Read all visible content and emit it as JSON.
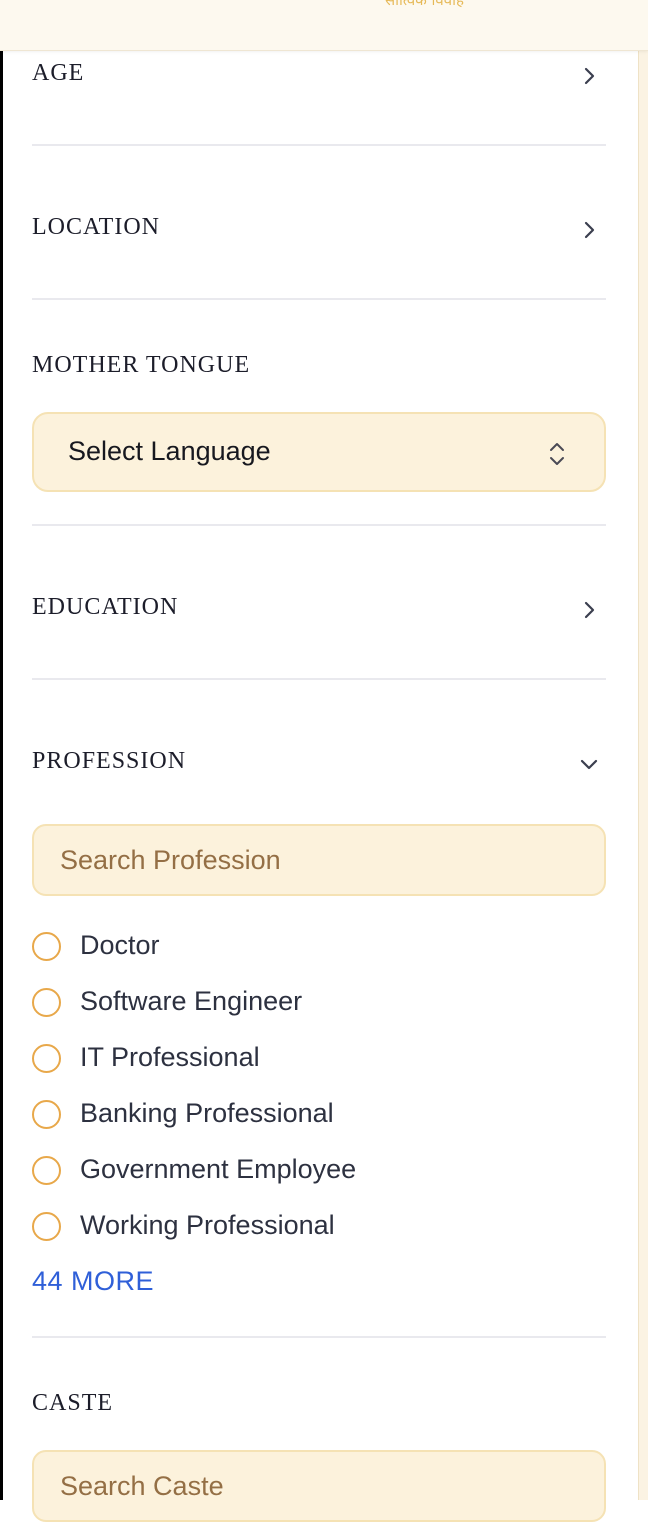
{
  "header": {
    "brand_text": "सात्विक विवाह"
  },
  "filters": {
    "age": {
      "title": "AGE"
    },
    "location": {
      "title": "LOCATION"
    },
    "mother_tongue": {
      "title": "MOTHER TONGUE",
      "select_value": "Select Language"
    },
    "education": {
      "title": "EDUCATION"
    },
    "profession": {
      "title": "PROFESSION",
      "search_placeholder": "Search Profession",
      "options": [
        {
          "label": "Doctor",
          "selected": false
        },
        {
          "label": "Software Engineer",
          "selected": false
        },
        {
          "label": "IT Professional",
          "selected": false
        },
        {
          "label": "Banking Professional",
          "selected": false
        },
        {
          "label": "Government Employee",
          "selected": false
        },
        {
          "label": "Working Professional",
          "selected": false
        }
      ],
      "more_label": "44 MORE"
    },
    "caste": {
      "title": "CASTE",
      "search_placeholder": "Search Caste"
    }
  },
  "colors": {
    "accent": "#e8a84a",
    "field_bg": "#fcf2dc",
    "link": "#2f5fd8",
    "icons": {
      "chevron_right": "chevron-right-icon",
      "chevron_down": "chevron-down-icon",
      "select_updown": "chevron-up-down-icon"
    }
  }
}
